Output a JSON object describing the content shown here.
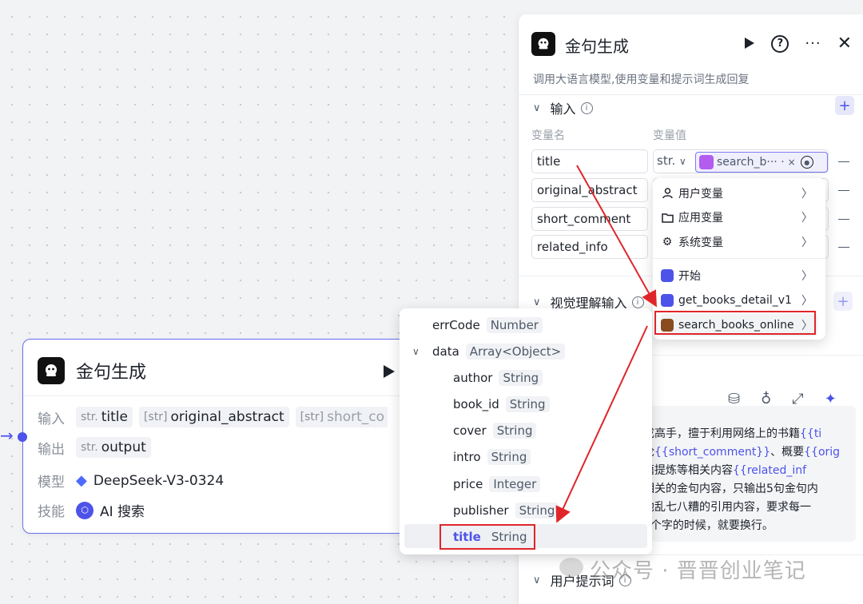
{
  "node": {
    "title": "金句生成",
    "input_label": "输入",
    "inputs": [
      {
        "type": "str.",
        "name": "title"
      },
      {
        "type": "[str]",
        "name": "original_abstract"
      },
      {
        "type": "[str]",
        "name": "short_co"
      }
    ],
    "output_label": "输出",
    "output": {
      "type": "str.",
      "name": "output"
    },
    "model_label": "模型",
    "model": "DeepSeek-V3-0324",
    "skill_label": "技能",
    "skill": "AI 搜索"
  },
  "panel": {
    "title": "金句生成",
    "description": "调用大语言模型,使用变量和提示词生成回复",
    "input_section": "输入",
    "col_name": "变量名",
    "col_value": "变量值",
    "variables": [
      {
        "name": "title",
        "type": "str.",
        "ref": "search_b··· ·"
      },
      {
        "name": "original_abstract"
      },
      {
        "name": "short_comment"
      },
      {
        "name": "related_info"
      }
    ],
    "vision_section": "视觉理解输入",
    "prompt_lines": [
      {
        "plain": "成高手，擅于利用网络上的书籍",
        "var": "{{ti"
      },
      {
        "plain": "论",
        "var": "{{short_comment}}",
        "plain2": "、概要",
        "var2": "{{orig"
      },
      {
        "plain": "籍提炼等相关内容",
        "var": "{{related_inf"
      },
      {
        "plain": "相关的金句内容，只输出5句金句内"
      },
      {
        "plain": "他乱七八糟的引用内容，要求每一"
      },
      {
        "plain": "2个字的时候，就要换行。"
      }
    ],
    "user_prompt_section": "用户提示词"
  },
  "menu": {
    "items": [
      "用户变量",
      "应用变量",
      "系统变量",
      "开始",
      "get_books_detail_v1",
      "search_books_online"
    ]
  },
  "tree": {
    "rows": [
      {
        "name": "errCode",
        "type": "Number"
      },
      {
        "name": "data",
        "type": "Array<Object>"
      },
      {
        "name": "author",
        "type": "String"
      },
      {
        "name": "book_id",
        "type": "String"
      },
      {
        "name": "cover",
        "type": "String"
      },
      {
        "name": "intro",
        "type": "String"
      },
      {
        "name": "price",
        "type": "Integer"
      },
      {
        "name": "publisher",
        "type": "String"
      },
      {
        "name": "title",
        "type": "String"
      }
    ]
  },
  "watermark": "公众号 · 晋晋创业笔记",
  "colors": {
    "accent": "#4d53e8",
    "annotation": "#e0252a"
  }
}
